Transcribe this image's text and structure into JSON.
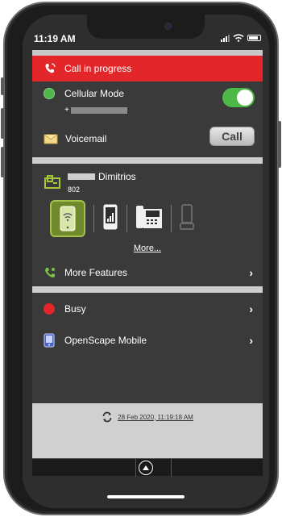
{
  "status_bar": {
    "time": "11:19 AM"
  },
  "call_banner": {
    "label": "Call in progress",
    "color": "#e2262a"
  },
  "cellular": {
    "label": "Cellular Mode",
    "number_prefix": "+",
    "toggle_on": true,
    "status_color": "#4cb848"
  },
  "voicemail": {
    "label": "Voicemail",
    "call_button": "Call"
  },
  "user": {
    "name": "Dimitrios",
    "extension": "802"
  },
  "devices": {
    "items": [
      {
        "name": "smartphone-device-icon",
        "selected": true
      },
      {
        "name": "mobile-phone-device-icon",
        "selected": false
      },
      {
        "name": "desk-phone-device-icon",
        "selected": false
      },
      {
        "name": "handset-device-icon",
        "selected": false
      }
    ],
    "more_link": "More..."
  },
  "more_features": {
    "label": "More Features"
  },
  "presence": {
    "label": "Busy",
    "color": "#e2262a"
  },
  "app_entry": {
    "label": "OpenScape Mobile"
  },
  "sync": {
    "timestamp": "28 Feb 2020, 11:19:18 AM"
  }
}
